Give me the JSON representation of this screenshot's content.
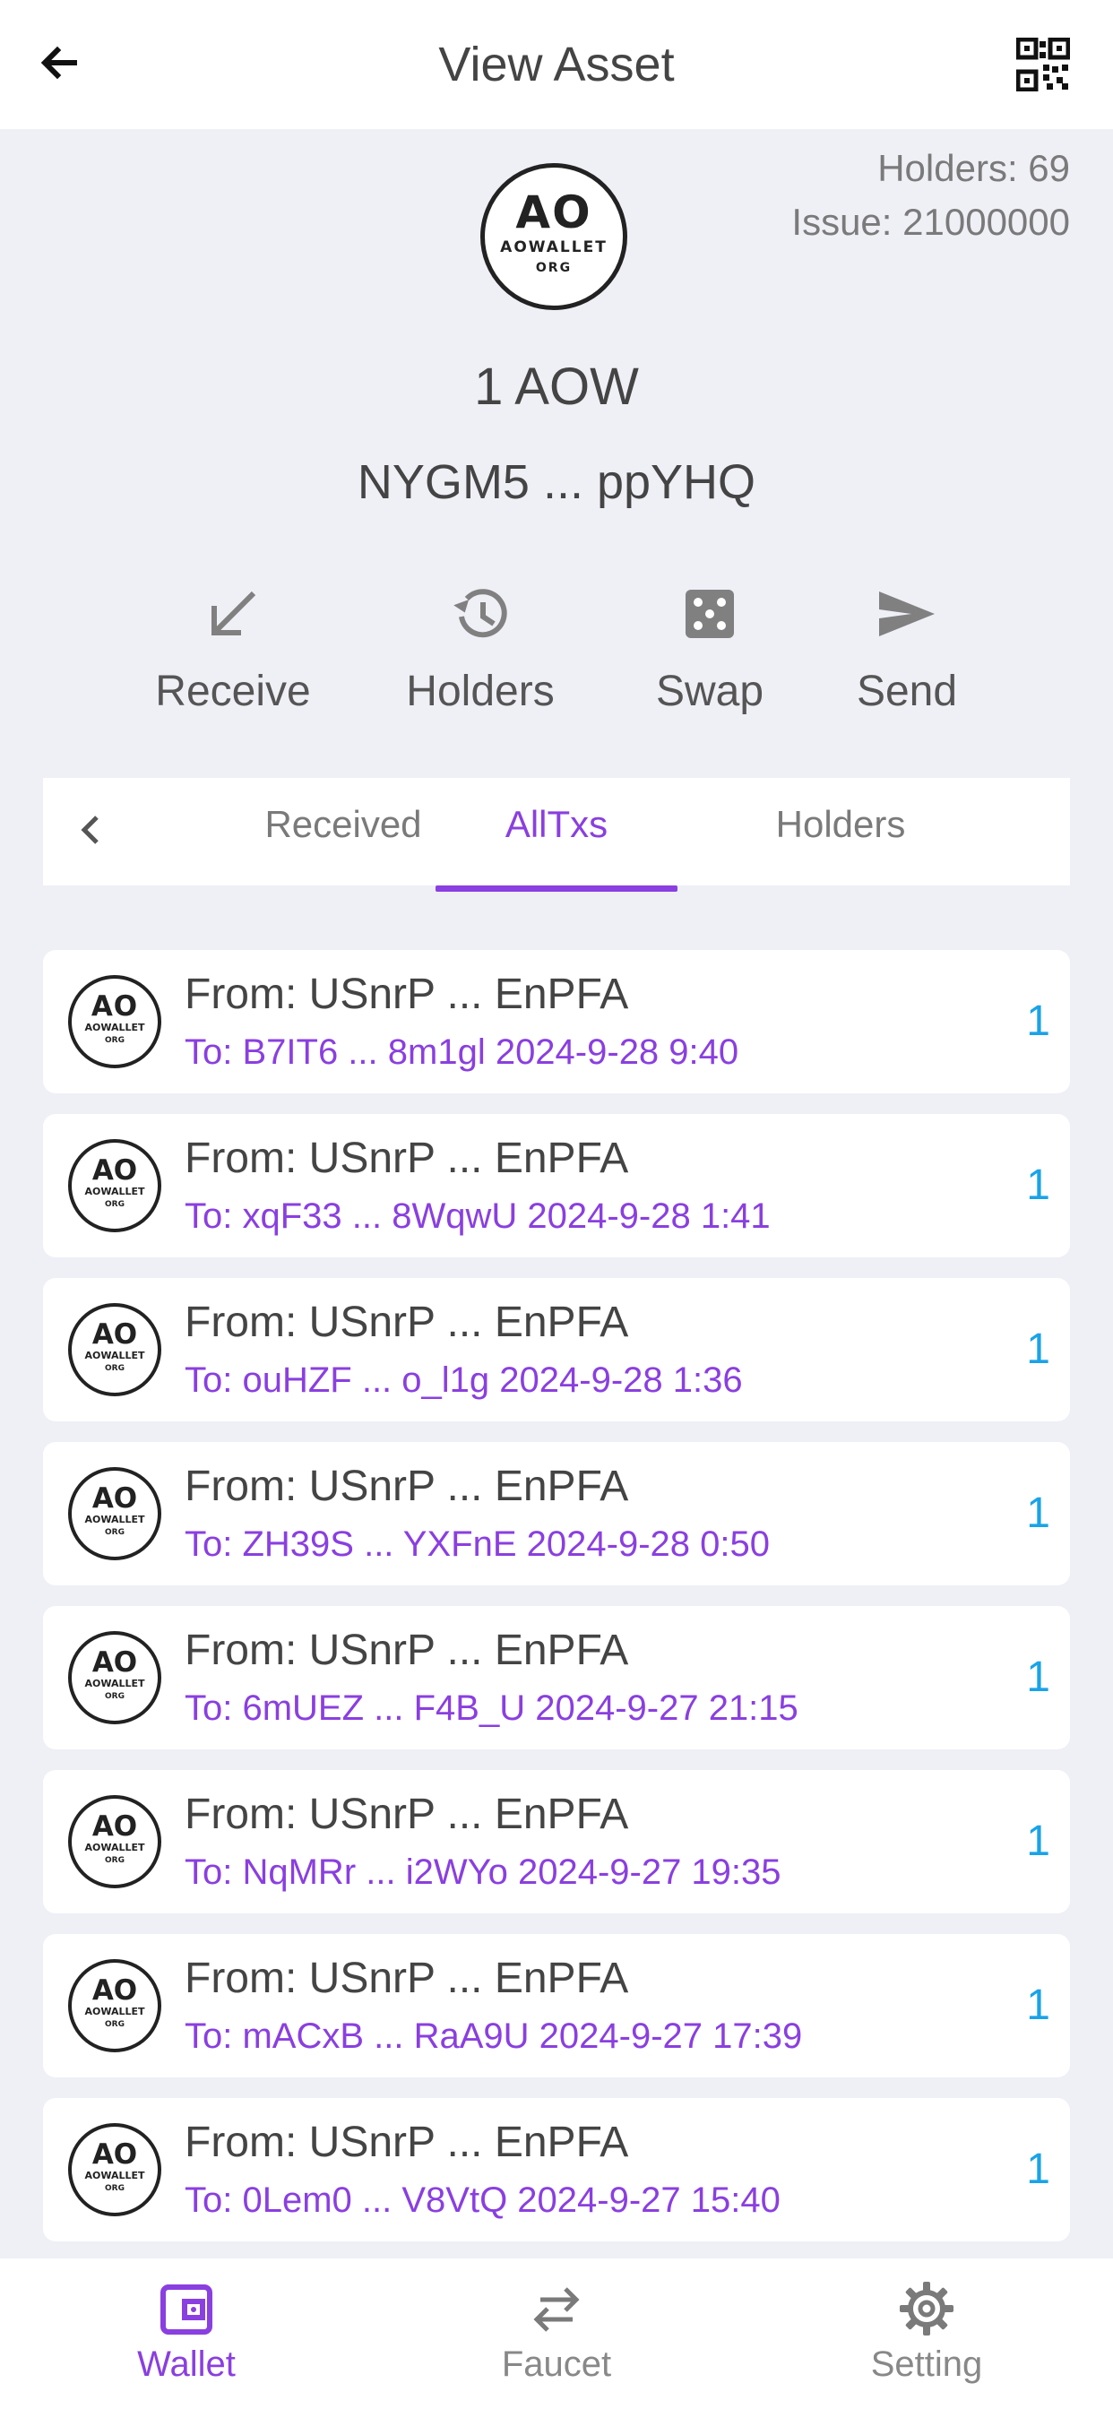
{
  "header": {
    "title": "View Asset"
  },
  "asset": {
    "holders_label": "Holders: 69",
    "issue_label": "Issue: 21000000",
    "logo": {
      "main": "AO",
      "sub": "AOWALLET",
      "org": "ORG"
    },
    "balance": "1 AOW",
    "address": "NYGM5 ... ppYHQ"
  },
  "actions": [
    {
      "label": "Receive",
      "icon": "receive-arrow-icon"
    },
    {
      "label": "Holders",
      "icon": "history-icon"
    },
    {
      "label": "Swap",
      "icon": "dice-icon"
    },
    {
      "label": "Send",
      "icon": "send-icon"
    }
  ],
  "tabs": [
    {
      "label": "Received"
    },
    {
      "label": "AllTxs"
    },
    {
      "label": "Holders"
    }
  ],
  "active_tab": "AllTxs",
  "transactions": [
    {
      "from": "From: USnrP ... EnPFA",
      "to": "To: B7IT6 ... 8m1gl 2024-9-28 9:40",
      "amount": "1"
    },
    {
      "from": "From: USnrP ... EnPFA",
      "to": "To: xqF33 ... 8WqwU 2024-9-28 1:41",
      "amount": "1"
    },
    {
      "from": "From: USnrP ... EnPFA",
      "to": "To: ouHZF ... o_l1g 2024-9-28 1:36",
      "amount": "1"
    },
    {
      "from": "From: USnrP ... EnPFA",
      "to": "To: ZH39S ... YXFnE 2024-9-28 0:50",
      "amount": "1"
    },
    {
      "from": "From: USnrP ... EnPFA",
      "to": "To: 6mUEZ ... F4B_U 2024-9-27 21:15",
      "amount": "1"
    },
    {
      "from": "From: USnrP ... EnPFA",
      "to": "To: NqMRr ... i2WYo 2024-9-27 19:35",
      "amount": "1"
    },
    {
      "from": "From: USnrP ... EnPFA",
      "to": "To: mACxB ... RaA9U 2024-9-27 17:39",
      "amount": "1"
    },
    {
      "from": "From: USnrP ... EnPFA",
      "to": "To: 0Lem0 ... V8VtQ 2024-9-27 15:40",
      "amount": "1"
    }
  ],
  "bottom_nav": [
    {
      "label": "Wallet",
      "icon": "wallet-icon"
    },
    {
      "label": "Faucet",
      "icon": "swap-arrows-icon"
    },
    {
      "label": "Setting",
      "icon": "gear-icon"
    }
  ],
  "colors": {
    "accent": "#8a3fe0",
    "amount": "#1aa3e8",
    "background": "#efeff6",
    "text": "#444444"
  }
}
